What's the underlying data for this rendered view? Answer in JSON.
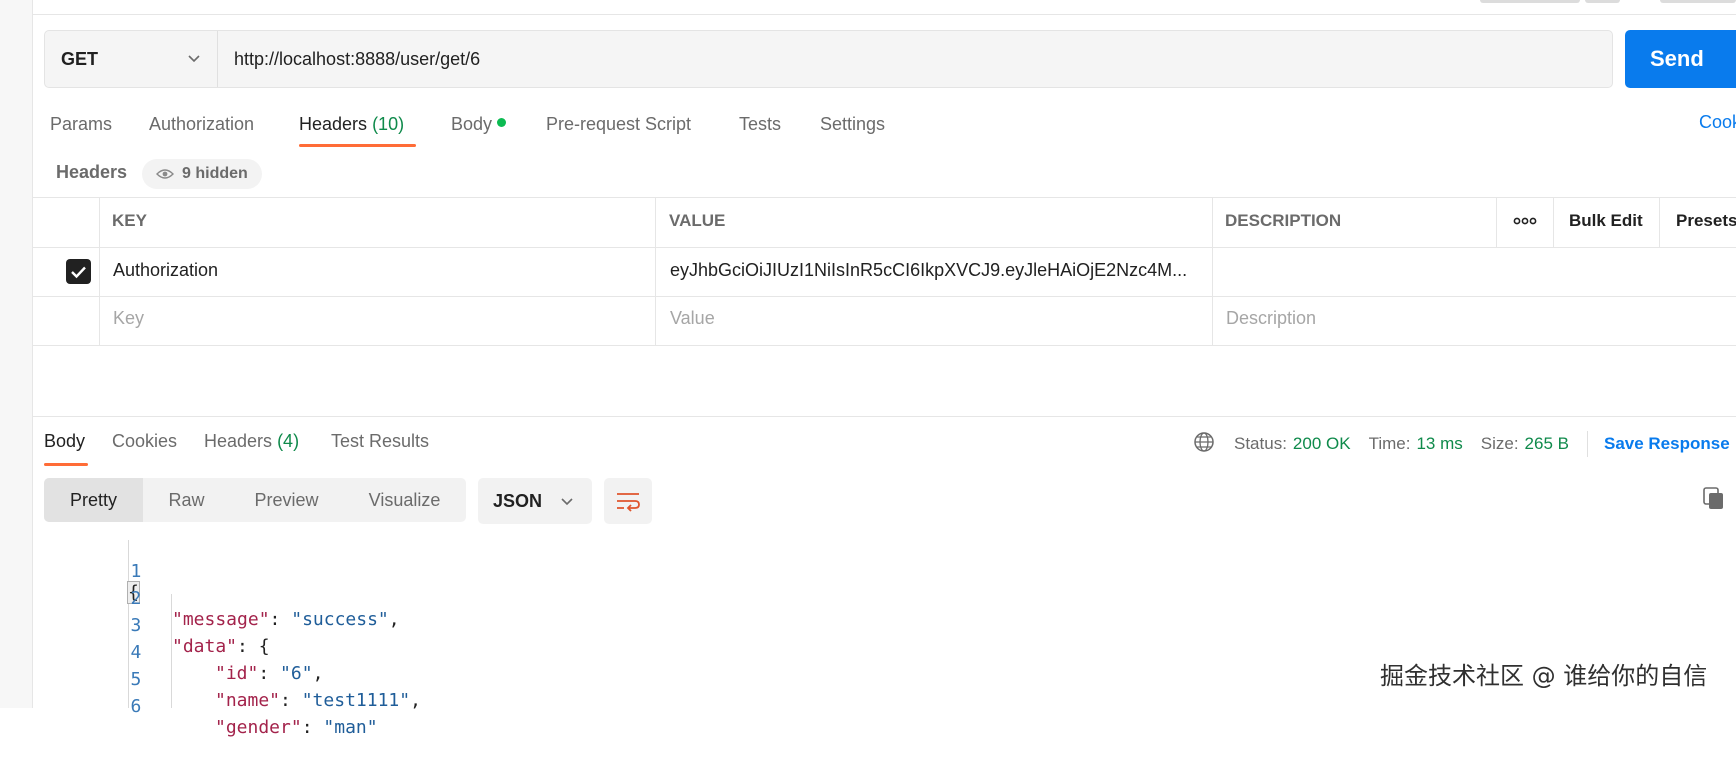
{
  "request": {
    "method": "GET",
    "url": "http://localhost:8888/user/get/6",
    "send_label": "Send"
  },
  "request_tabs": {
    "params": "Params",
    "authorization": "Authorization",
    "headers": "Headers",
    "headers_count": "(10)",
    "body": "Body",
    "pre_request": "Pre-request Script",
    "tests": "Tests",
    "settings": "Settings",
    "cookies": "Cook"
  },
  "headers_section": {
    "title": "Headers",
    "hidden_label": "9 hidden"
  },
  "headers_table": {
    "columns": {
      "key": "KEY",
      "value": "VALUE",
      "description": "DESCRIPTION",
      "bulk_edit": "Bulk Edit",
      "presets": "Presets"
    },
    "rows": [
      {
        "checked": true,
        "key": "Authorization",
        "value": "eyJhbGciOiJIUzI1NiIsInR5cCI6IkpXVCJ9.eyJleHAiOjE2Nzc4M...",
        "description": ""
      }
    ],
    "placeholders": {
      "key": "Key",
      "value": "Value",
      "description": "Description"
    }
  },
  "response_tabs": {
    "body": "Body",
    "cookies": "Cookies",
    "headers": "Headers",
    "headers_count": "(4)",
    "test_results": "Test Results"
  },
  "response_meta": {
    "status_label": "Status:",
    "status_value": "200 OK",
    "time_label": "Time:",
    "time_value": "13 ms",
    "size_label": "Size:",
    "size_value": "265 B",
    "save_response": "Save Response"
  },
  "view_modes": {
    "pretty": "Pretty",
    "raw": "Raw",
    "preview": "Preview",
    "visualize": "Visualize",
    "format": "JSON"
  },
  "code_lines": [
    {
      "num": "1",
      "text": "{"
    },
    {
      "num": "2",
      "key": "\"message\"",
      "value": "\"success\"",
      "tail": ","
    },
    {
      "num": "3",
      "key": "\"data\"",
      "tail": ": {"
    },
    {
      "num": "4",
      "key": "\"id\"",
      "value": "\"6\"",
      "tail": ","
    },
    {
      "num": "5",
      "key": "\"name\"",
      "value": "\"test1111\"",
      "tail": ","
    },
    {
      "num": "6",
      "key": "\"gender\"",
      "value": "\"man\"",
      "tail": ""
    }
  ],
  "watermark": "掘金技术社区 @ 谁给你的自信",
  "colors": {
    "accent_orange": "#ff6c37",
    "send_blue": "#097bed",
    "status_green": "#0f8a4b",
    "json_key": "#a3234b",
    "json_string": "#1f5d99"
  }
}
